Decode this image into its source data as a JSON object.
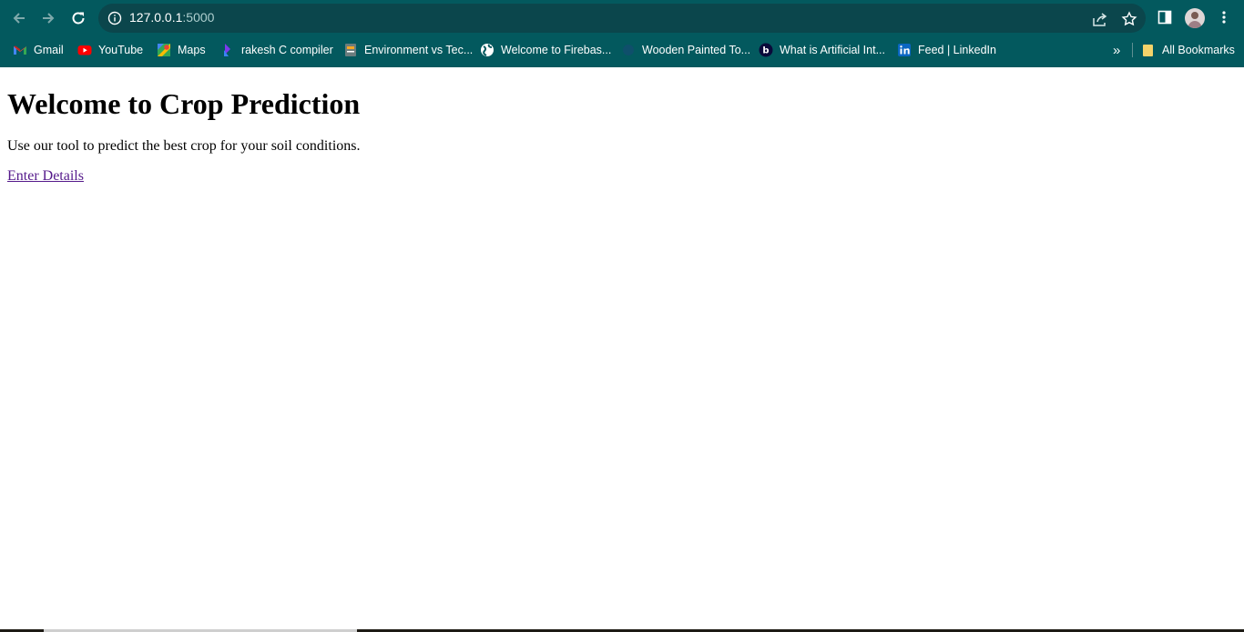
{
  "browser": {
    "url_host": "127.0.0.1",
    "url_port": ":5000",
    "bookmarks": [
      {
        "label": "Gmail",
        "icon": "gmail-icon"
      },
      {
        "label": "YouTube",
        "icon": "youtube-icon"
      },
      {
        "label": "Maps",
        "icon": "maps-icon"
      },
      {
        "label": "rakesh C compiler",
        "icon": "compiler-icon"
      },
      {
        "label": "Environment vs Tec...",
        "icon": "doc-icon"
      },
      {
        "label": "Welcome to Firebas...",
        "icon": "globe-icon"
      },
      {
        "label": "Wooden Painted To...",
        "icon": "site-icon"
      },
      {
        "label": "What is Artificial Int...",
        "icon": "b-icon"
      },
      {
        "label": "Feed | LinkedIn",
        "icon": "linkedin-icon"
      }
    ],
    "overflow_label": "»",
    "all_bookmarks_label": "All Bookmarks"
  },
  "page": {
    "heading": "Welcome to Crop Prediction",
    "description": "Use our tool to predict the best crop for your soil conditions.",
    "link_label": "Enter Details"
  },
  "colors": {
    "chrome_bg": "#03595e",
    "omnibox_bg": "#0b464c",
    "visited_link": "#551a8b"
  }
}
